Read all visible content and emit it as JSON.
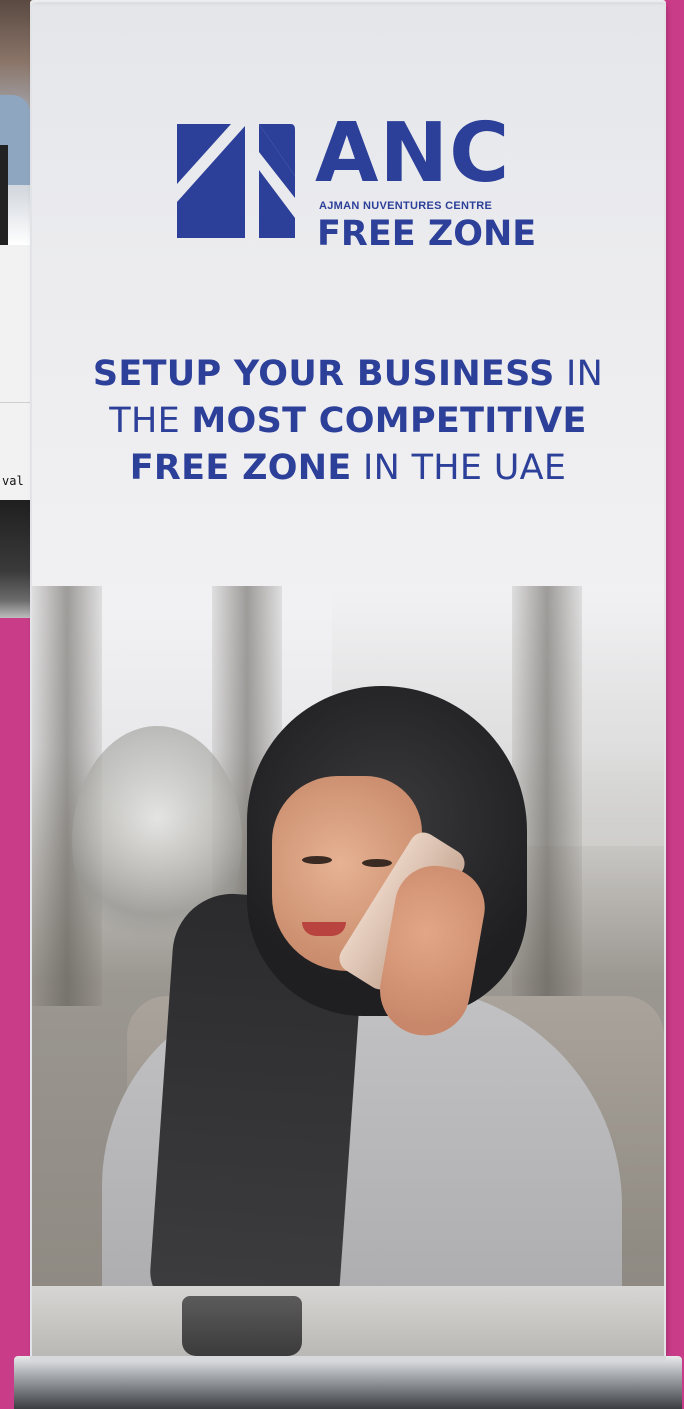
{
  "background_screen": {
    "text_snippet": "val S"
  },
  "banner": {
    "logo": {
      "letters": "ANC",
      "subtitle": "AJMAN NUVENTURES CENTRE",
      "zone": "FREE ZONE"
    },
    "headline": {
      "line1_bold": "SETUP YOUR BUSINESS",
      "line1_regular": " IN",
      "line2_regular": "THE ",
      "line2_bold": "MOST COMPETITIVE",
      "line3_bold": "FREE ZONE",
      "line3_regular": " IN THE UAE"
    }
  },
  "colors": {
    "brand_blue": "#2c3f99",
    "page_background": "#c93c88"
  },
  "photo": {
    "subject": "woman in hijab talking on phone"
  }
}
